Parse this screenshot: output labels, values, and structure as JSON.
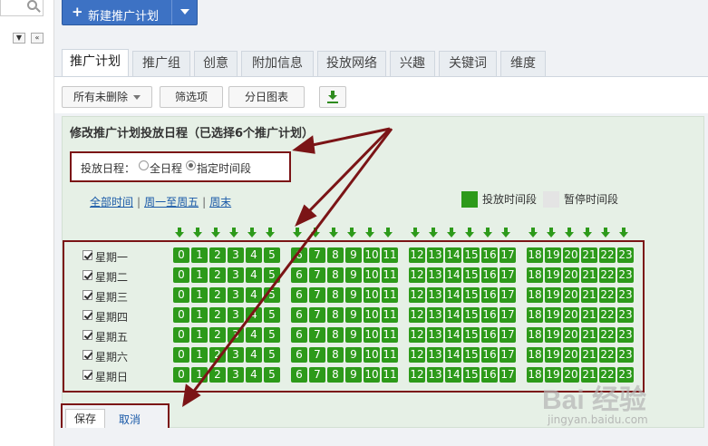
{
  "toolbar": {
    "new_plan_label": "新建推广计划",
    "filter_select": "所有未删除",
    "filter_button": "筛选项",
    "daily_chart_button": "分日图表"
  },
  "tabs": [
    "推广计划",
    "推广组",
    "创意",
    "附加信息",
    "投放网络",
    "兴趣",
    "关键词",
    "维度"
  ],
  "panel": {
    "title": "修改推广计划投放日程（已选择6个推广计划）",
    "schedule_label": "投放日程：",
    "option_all": "全日程",
    "option_specific": "指定时间段",
    "selected_option": "指定时间段",
    "quick_links": [
      "全部时间",
      "周一至周五",
      "周末"
    ],
    "legend_active": "投放时间段",
    "legend_paused": "暂停时间段",
    "active_color": "#2d9a1a",
    "paused_color": "#e4e4e4"
  },
  "days": [
    "星期一",
    "星期二",
    "星期三",
    "星期四",
    "星期五",
    "星期六",
    "星期日"
  ],
  "hours": [
    "0",
    "1",
    "2",
    "3",
    "4",
    "5",
    "6",
    "7",
    "8",
    "9",
    "10",
    "11",
    "12",
    "13",
    "14",
    "15",
    "16",
    "17",
    "18",
    "19",
    "20",
    "21",
    "22",
    "23"
  ],
  "actions": {
    "save": "保存",
    "cancel": "取消"
  },
  "watermark": {
    "brand": "Bai 经验",
    "url": "jingyan.baidu.com"
  },
  "annotation_color": "#7b1416"
}
